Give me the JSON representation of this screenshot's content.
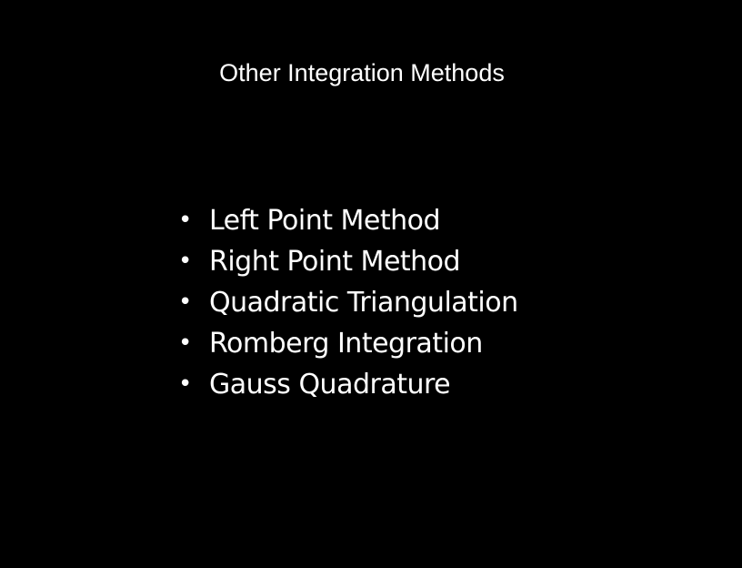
{
  "slide": {
    "title": "Other Integration Methods",
    "bullet_glyph": "•",
    "bullets": [
      "Left Point Method",
      "Right Point Method",
      "Quadratic Triangulation",
      "Romberg Integration",
      "Gauss Quadrature"
    ],
    "colors": {
      "background": "#000000",
      "text": "#ffffff"
    }
  }
}
